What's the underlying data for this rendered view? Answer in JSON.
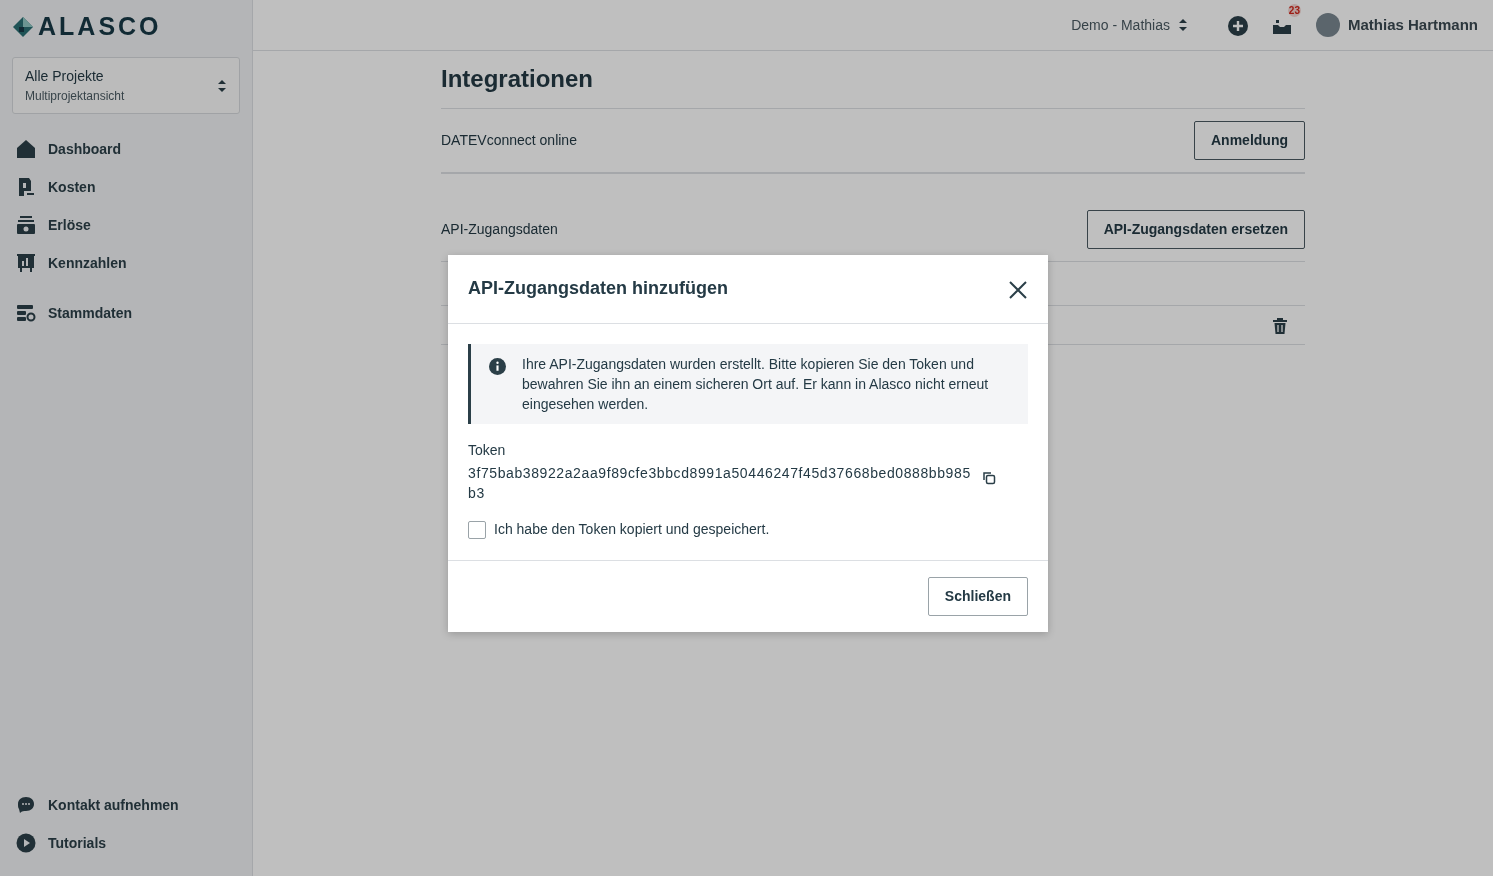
{
  "sidebar": {
    "logo": "ALASCO",
    "project_selector": {
      "title": "Alle Projekte",
      "subtitle": "Multiprojektansicht"
    },
    "items": [
      {
        "label": "Dashboard"
      },
      {
        "label": "Kosten"
      },
      {
        "label": "Erlöse"
      },
      {
        "label": "Kennzahlen"
      },
      {
        "label": "Stammdaten"
      }
    ],
    "footer_items": [
      {
        "label": "Kontakt aufnehmen"
      },
      {
        "label": "Tutorials"
      }
    ]
  },
  "topbar": {
    "workspace": "Demo - Mathias",
    "notification_count": "23",
    "user_name": "Mathias Hartmann"
  },
  "page": {
    "title": "Integrationen",
    "rows": [
      {
        "label": "DATEVconnect online",
        "button": "Anmeldung"
      },
      {
        "label": "API-Zugangsdaten",
        "button": "API-Zugangsdaten ersetzen"
      }
    ]
  },
  "modal": {
    "title": "API-Zugangsdaten hinzufügen",
    "info": "Ihre API-Zugangsdaten wurden erstellt. Bitte kopieren Sie den Token und bewahren Sie ihn an einem sicheren Ort auf. Er kann in Alasco nicht erneut eingesehen werden.",
    "token_label": "Token",
    "token": "3f75bab38922a2aa9f89cfe3bbcd8991a50446247f45d37668bed0888bb985b3",
    "confirm": {
      "label": "Ich habe den Token kopiert und gespeichert.",
      "checked": false
    },
    "close_button": "Schließen"
  }
}
